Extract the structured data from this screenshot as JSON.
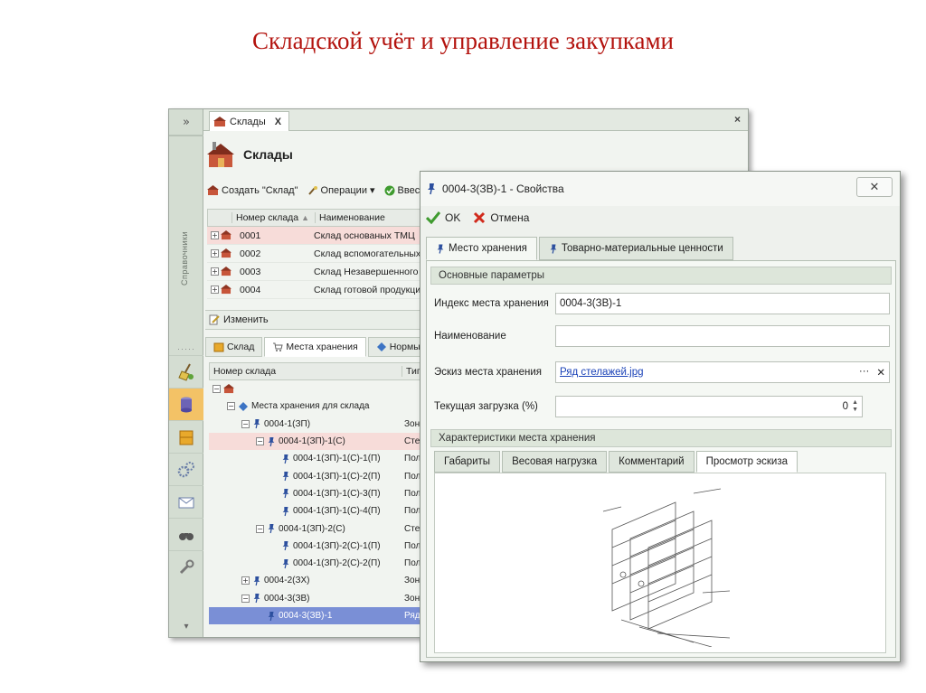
{
  "slide": {
    "title": "Складской учёт и управление закупками"
  },
  "colors": {
    "title_red": "#b3120d",
    "selected_pink": "#f7dcd9",
    "selected_blue": "#7a8fd6",
    "active_strip": "#f3c266",
    "link": "#1b43b8"
  },
  "main": {
    "strip_chevron": "»",
    "strip_label": "Справочники",
    "strip_dots": "·····",
    "strip_bottom": "▾",
    "strip_icons": [
      "broom-icon",
      "database-icon",
      "package-icon",
      "gears-icon",
      "envelope-icon",
      "binoculars-icon",
      "wrench-icon"
    ],
    "doc_tab": {
      "label": "Склады",
      "close": "X"
    },
    "close": "×",
    "header_title": "Склады",
    "toolbar": {
      "create": "Создать \"Склад\"",
      "operations": "Операции",
      "enter": "Ввести"
    },
    "grid": {
      "columns": [
        "Номер склада",
        "Наименование"
      ],
      "rows": [
        {
          "num": "0001",
          "name": "Склад основаных ТМЦ",
          "selected": true
        },
        {
          "num": "0002",
          "name": "Склад вспомогательных"
        },
        {
          "num": "0003",
          "name": "Склад Незавершенного п"
        },
        {
          "num": "0004",
          "name": "Склад готовой продукци"
        }
      ]
    },
    "edit_label": "Изменить",
    "subtabs": [
      "Склад",
      "Места хранения",
      "Нормы за"
    ],
    "tree": {
      "columns": [
        "Номер склада",
        "Тип"
      ],
      "rows": [
        {
          "label": "",
          "type": "",
          "level": 0
        },
        {
          "label": "Места хранения для склада",
          "type": "",
          "level": 1
        },
        {
          "label": "0004-1(ЗП)",
          "type": "Зона",
          "level": 2
        },
        {
          "label": "0004-1(ЗП)-1(С)",
          "type": "Стел",
          "level": 3,
          "pink": true
        },
        {
          "label": "0004-1(ЗП)-1(С)-1(П)",
          "type": "Пол",
          "level": 4
        },
        {
          "label": "0004-1(ЗП)-1(С)-2(П)",
          "type": "Пол",
          "level": 4
        },
        {
          "label": "0004-1(ЗП)-1(С)-3(П)",
          "type": "Пол",
          "level": 4
        },
        {
          "label": "0004-1(ЗП)-1(С)-4(П)",
          "type": "Пол",
          "level": 4
        },
        {
          "label": "0004-1(ЗП)-2(С)",
          "type": "Стел",
          "level": 3
        },
        {
          "label": "0004-1(ЗП)-2(С)-1(П)",
          "type": "Пол",
          "level": 4
        },
        {
          "label": "0004-1(ЗП)-2(С)-2(П)",
          "type": "Пол",
          "level": 4
        },
        {
          "label": "0004-2(ЗХ)",
          "type": "Зона",
          "level": 2
        },
        {
          "label": "0004-3(ЗВ)",
          "type": "Зона",
          "level": 2
        },
        {
          "label": "0004-3(ЗВ)-1",
          "type": "Ряд",
          "level": 3,
          "blue": true
        }
      ]
    }
  },
  "dialog": {
    "title": "0004-3(ЗВ)-1 - Свойства",
    "close": "✕",
    "ok": "OK",
    "cancel": "Отмена",
    "tabs": [
      "Место хранения",
      "Товарно-материальные ценности"
    ],
    "group_main": "Основные параметры",
    "fields": {
      "index_label": "Индекс места хранения",
      "index_value": "0004-3(ЗВ)-1",
      "name_label": "Наименование",
      "name_value": "",
      "sketch_label": "Эскиз места хранения",
      "sketch_value": "Ряд стелажей.jpg",
      "sketch_more": "···",
      "sketch_clear": "✕",
      "load_label": "Текущая загрузка (%)",
      "load_value": "0"
    },
    "group_chars": "Характеристики места хранения",
    "inner_tabs": [
      "Габариты",
      "Весовая нагрузка",
      "Комментарий",
      "Просмотр эскиза"
    ]
  }
}
